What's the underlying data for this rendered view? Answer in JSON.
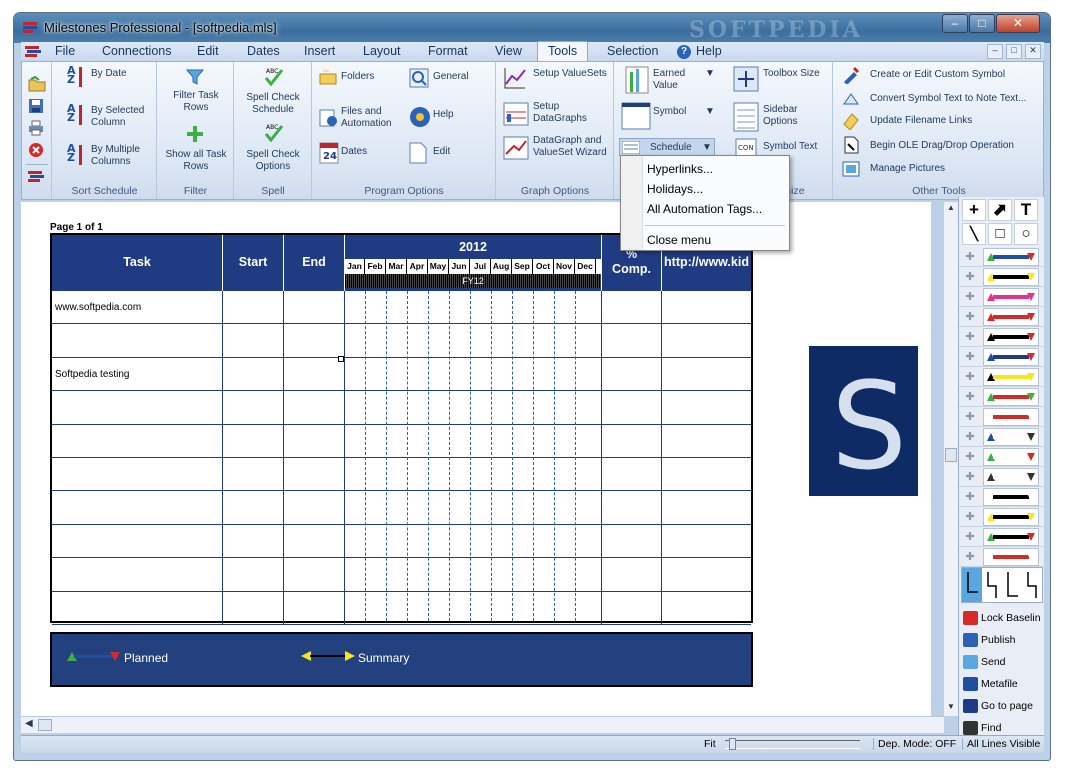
{
  "window": {
    "title": "Milestones Professional - [softpedia.mls]",
    "watermark": "SOFTPEDIA"
  },
  "menu": {
    "items": [
      "File",
      "Connections",
      "Edit",
      "Dates",
      "Insert",
      "Layout",
      "Format",
      "View",
      "Tools",
      "Selection",
      "Help"
    ],
    "active": "Tools"
  },
  "ribbon": {
    "sort": {
      "by_date": "By Date",
      "by_selected": "By Selected Column",
      "by_multiple": "By Multiple Columns",
      "label": "Sort Schedule"
    },
    "filter": {
      "filter_task": "Filter Task Rows",
      "show_all": "Show all Task Rows",
      "label": "Filter"
    },
    "spell": {
      "check": "Spell Check Schedule",
      "options": "Spell Check Options",
      "label": "Spell"
    },
    "program": {
      "folders": "Folders",
      "general": "General",
      "files": "Files and Automation",
      "help": "Help",
      "dates": "Dates",
      "edit": "Edit",
      "label": "Program Options"
    },
    "graph": {
      "setup_valuesets": "Setup ValueSets",
      "setup_datagraphs": "Setup DataGraphs",
      "wizard": "DataGraph and ValueSet Wizard",
      "label": "Graph Options"
    },
    "customize": {
      "earned_value": "Earned Value",
      "symbol": "Symbol",
      "schedule": "Schedule",
      "toolbox_size": "Toolbox Size",
      "sidebar": "Sidebar Options",
      "symbol_text": "Symbol Text",
      "label": "mize"
    },
    "other": {
      "create_symbol": "Create or Edit Custom Symbol",
      "convert": "Convert Symbol Text to Note Text...",
      "update_links": "Update Filename Links",
      "begin_ole": "Begin OLE Drag/Drop Operation",
      "manage_pictures": "Manage Pictures",
      "label": "Other Tools"
    }
  },
  "dropdown": {
    "items": [
      "Hyperlinks...",
      "Holidays...",
      "All Automation Tags...",
      "Close menu"
    ]
  },
  "schedule": {
    "page": "Page 1 of 1",
    "headers": {
      "task": "Task",
      "start": "Start",
      "end": "End",
      "year": "2012",
      "comp": "% Comp.",
      "url": "http://www.kid"
    },
    "months": [
      "Jan",
      "Feb",
      "Mar",
      "Apr",
      "May",
      "Jun",
      "Jul",
      "Aug",
      "Sep",
      "Oct",
      "Nov",
      "Dec"
    ],
    "fy": "FY12",
    "rows": [
      "www.softpedia.com",
      "",
      "Softpedia testing",
      "",
      "",
      "",
      "",
      "",
      "",
      ""
    ]
  },
  "legend": {
    "planned": "Planned",
    "summary": "Summary"
  },
  "toolbox": {
    "buttons": [
      "Lock Baselin",
      "Publish",
      "Send",
      "Metafile",
      "Go to page",
      "Find"
    ]
  },
  "status": {
    "fit": "Fit",
    "dep_mode": "Dep. Mode: OFF",
    "lines": "All Lines Visible"
  }
}
